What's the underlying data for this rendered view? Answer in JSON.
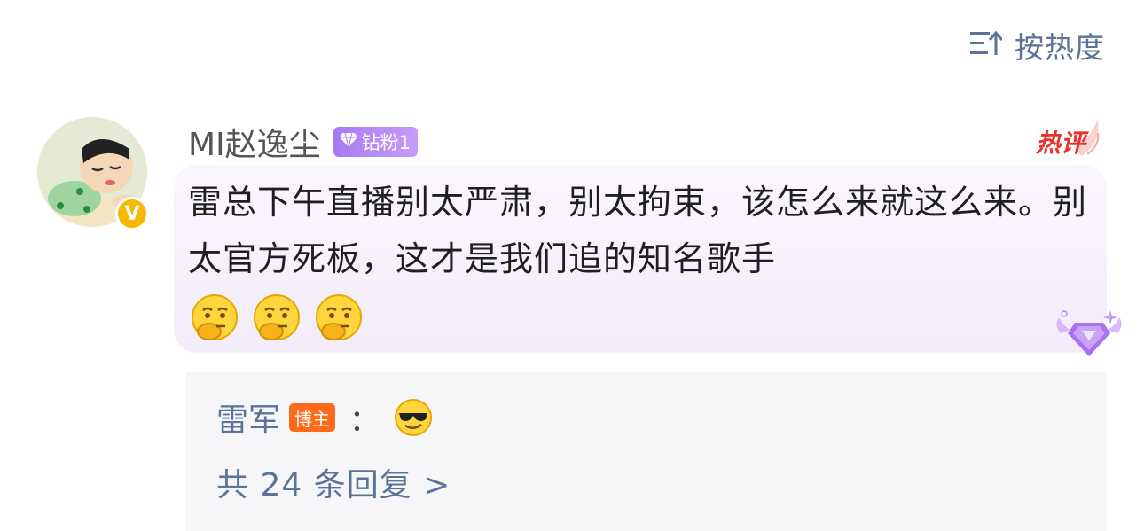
{
  "sort": {
    "label": "按热度",
    "icon": "sort-icon"
  },
  "comment": {
    "username": "MI赵逸尘",
    "fan_badge": "钻粉1",
    "verified_mark": "V",
    "hot_tag": "热评",
    "text": "雷总下午直播别太严肃，别太拘束，该怎么来就这么来。别太官方死板，这才是我们追的知名歌手",
    "emojis": [
      "thinking-face-emoji",
      "thinking-face-emoji",
      "thinking-face-emoji"
    ],
    "reply": {
      "author": "雷军",
      "author_badge": "博主",
      "separator": "：",
      "emoji": "cool-sunglasses-emoji"
    },
    "more_replies": "共 24 条回复 >"
  },
  "colors": {
    "link_blue": "#5a7396",
    "hot_red": "#e8332a",
    "fan_purple": "#a77af4",
    "blogger_orange": "#ff6a1a",
    "verified_yellow": "#f6b800"
  }
}
